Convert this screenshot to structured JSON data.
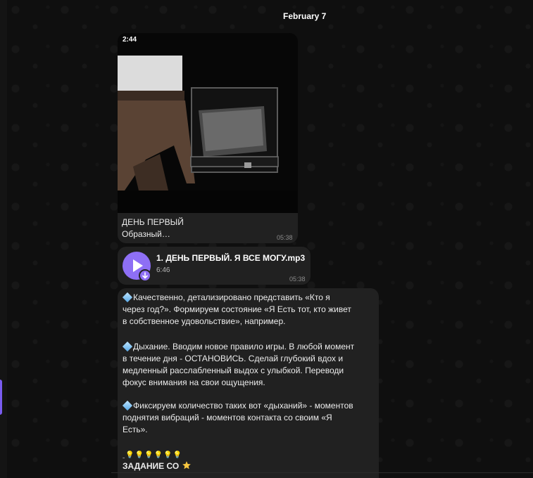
{
  "date_separator": "February 7",
  "video_message": {
    "duration": "2:44",
    "title": "ДЕНЬ ПЕРВЫЙ",
    "subtitle": "Образный…",
    "time": "05:38"
  },
  "audio_message": {
    "title": "1. ДЕНЬ ПЕРВЫЙ. Я ВСЕ МОГУ.mp3",
    "duration": "6:46",
    "time": "05:38"
  },
  "text_message": {
    "paragraphs": [
      {
        "lines": [
          "Качественно, детализировано  представить «Кто я",
          "через год?». Формируем состояние «Я Есть тот, кто живет",
          "в собственное удовольствие», например."
        ]
      },
      {
        "lines": [
          "Дыхание. Вводим новое правило игры. В любой момент",
          "в течение дня - ОСТАНОВИСЬ. Сделай глубокий вдох и",
          "медленный расслабленный выдох с улыбкой. Переводи",
          "фокус внимания на свои ощущения."
        ]
      },
      {
        "lines": [
          "Фиксируем количество таких вот «дыханий» - моментов",
          "поднятия вибраций - моментов контакта со своим «Я",
          "Есть»."
        ]
      }
    ],
    "bulbs": "ˍ💡💡💡💡💡💡",
    "task": "ЗАДАНИЕ СО"
  },
  "icons": {
    "play": "play-icon",
    "download": "download-arrow-icon",
    "diamond": "blue-diamond-icon",
    "star": "star-icon"
  },
  "colors": {
    "accent": "#8e6ff5",
    "bubble": "#212121",
    "background": "#0f0f0f"
  }
}
